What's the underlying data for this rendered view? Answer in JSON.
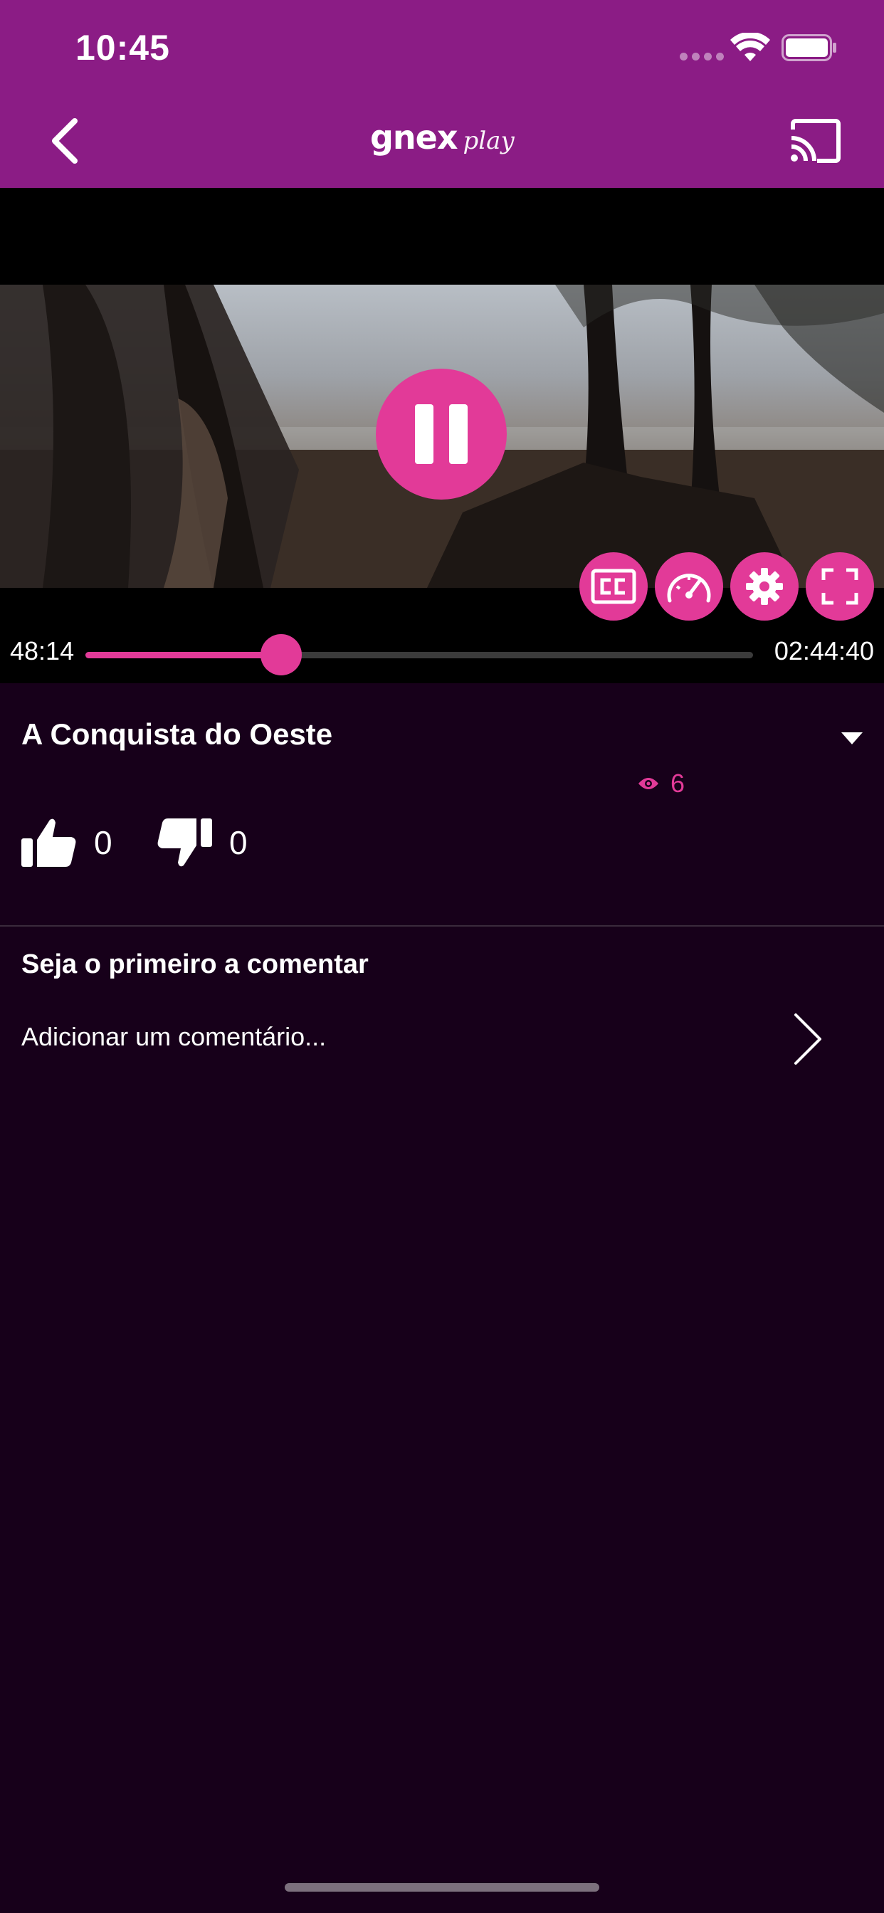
{
  "status_bar": {
    "time": "10:45"
  },
  "header": {
    "logo_main": "gnex",
    "logo_sub": "play",
    "back_icon": "chevron-left-icon",
    "cast_icon": "cast-icon"
  },
  "player": {
    "current_time": "48:14",
    "total_time": "02:44:40",
    "progress_fraction": 0.293,
    "state": "playing",
    "controls": [
      "closed-captions-icon",
      "speed-icon",
      "settings-gear-icon",
      "fullscreen-icon"
    ]
  },
  "video": {
    "title": "A Conquista do Oeste",
    "views": "6",
    "likes": "0",
    "dislikes": "0"
  },
  "comments": {
    "heading": "Seja o primeiro a comentar",
    "placeholder": "Adicionar um comentário..."
  },
  "colors": {
    "header_bg": "#8b1c85",
    "page_bg": "#17001a",
    "accent": "#e23a98"
  }
}
